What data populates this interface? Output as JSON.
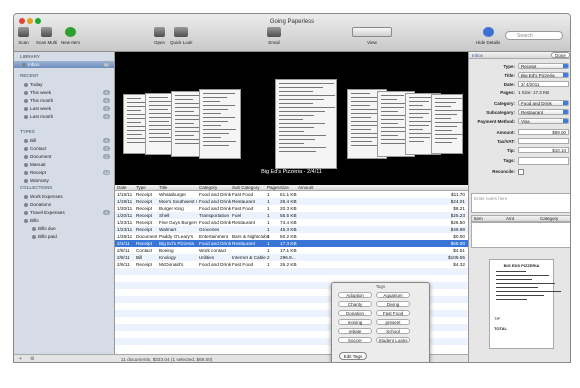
{
  "window": {
    "title": "Going Paperless"
  },
  "toolbar": {
    "scan": "Scan",
    "scan_multi": "Scan Multi",
    "new_item": "New Item",
    "open": "Open",
    "quick_look": "Quick Look",
    "email": "Email",
    "view": "View",
    "hide_details": "Hide Details",
    "search_placeholder": "Search"
  },
  "sidebar": {
    "library_header": "LIBRARY",
    "inbox": "Inbox",
    "inbox_count": "51",
    "recent_header": "RECENT",
    "recent": [
      {
        "label": "Today",
        "count": ""
      },
      {
        "label": "This week",
        "count": "4"
      },
      {
        "label": "This month",
        "count": "6"
      },
      {
        "label": "Last week",
        "count": "3"
      },
      {
        "label": "Last month",
        "count": "9"
      }
    ],
    "types_header": "TYPES",
    "types": [
      {
        "label": "Bill",
        "count": "4"
      },
      {
        "label": "Contact",
        "count": "3"
      },
      {
        "label": "Document",
        "count": "2"
      },
      {
        "label": "Manual",
        "count": ""
      },
      {
        "label": "Receipt",
        "count": "18"
      },
      {
        "label": "Warranty",
        "count": ""
      }
    ],
    "collections_header": "COLLECTIONS",
    "collections": [
      {
        "label": "Work Expenses",
        "count": ""
      },
      {
        "label": "Donations",
        "count": ""
      },
      {
        "label": "Travel Expenses",
        "count": "4"
      }
    ],
    "bills": "Bills",
    "bills_due": "Bills due",
    "bills_paid": "Bills paid"
  },
  "coverflow": {
    "caption": "Big Ed's Pizzeria - 2/4/11"
  },
  "table": {
    "columns": [
      "Date",
      "Type",
      "Title",
      "Category",
      "Sub Category",
      "Pages",
      "Size",
      "Amount"
    ],
    "rows": [
      [
        "1/15/11",
        "Receipt",
        "Whataburger",
        "Food and Drink",
        "Fast Food",
        "1",
        "61.1 KB",
        "$11.70"
      ],
      [
        "1/19/11",
        "Receipt",
        "Moe's Southwest Grill",
        "Food and Drink",
        "Restaurant",
        "1",
        "26.4 KB",
        "$24.01"
      ],
      [
        "1/20/11",
        "Receipt",
        "Burger King",
        "Food and Drink",
        "Fast Food",
        "1",
        "20.3 KB",
        "$8.21"
      ],
      [
        "1/20/11",
        "Receipt",
        "Shell",
        "Transportation",
        "Fuel",
        "1",
        "55.5 KB",
        "$25.23"
      ],
      [
        "1/23/11",
        "Receipt",
        "Five Guys Burgers...",
        "Food and Drink",
        "Restaurant",
        "1",
        "74.4 KB",
        "$26.50"
      ],
      [
        "1/23/11",
        "Receipt",
        "Walmart",
        "Groceries",
        "",
        "1",
        "45.3 KB",
        "$49.99"
      ],
      [
        "1/28/11",
        "Document",
        "Paddy O'Leary's",
        "Entertainment",
        "Bars & Nightclubs",
        "1",
        "60.2 KB",
        "$0.00"
      ],
      [
        "2/4/11",
        "Receipt",
        "Big Ed's Pizzeria",
        "Food and Drink",
        "Restaurant",
        "1",
        "17.3 KB",
        "$69.00"
      ],
      [
        "2/9/11",
        "Contact",
        "Boeing",
        "Work contact",
        "",
        "1",
        "17.1 KB",
        "$4.51"
      ],
      [
        "2/9/11",
        "Bill",
        "Knology",
        "Utilities",
        "Internet & Cable",
        "2",
        "296.8...",
        "$109.55"
      ],
      [
        "2/9/11",
        "Receipt",
        "McDonald's",
        "Food and Drink",
        "Fast Food",
        "1",
        "26.2 KB",
        "$4.32"
      ]
    ],
    "selected_index": 7
  },
  "status": "11 documents, $333.04 (1 selected, $69.00)",
  "tags_panel": {
    "title": "Tags",
    "tags": [
      "Adoption",
      "Aquarium",
      "Charity",
      "Diving",
      "Donation",
      "Fast Food",
      "moving",
      "present",
      "rebate",
      "School",
      "Soccer",
      "Student Loans"
    ],
    "edit": "Edit Tags"
  },
  "inspector": {
    "header": "Inbox",
    "done": "Done",
    "fields": [
      {
        "label": "Type:",
        "value": "Receipt",
        "kind": "select"
      },
      {
        "label": "Title:",
        "value": "Big Ed's Pizzeria",
        "kind": "select"
      },
      {
        "label": "Date:",
        "value": "2/ 4/2011",
        "kind": "date"
      },
      {
        "label": "Pages:",
        "value": "1   Size: 17.3 KB",
        "kind": "text"
      },
      {
        "label": "Category:",
        "value": "Food and Drink",
        "kind": "select"
      },
      {
        "label": "Subcategory:",
        "value": "Restaurant",
        "kind": "select"
      },
      {
        "label": "Payment Method:",
        "value": "Visa",
        "kind": "select"
      },
      {
        "label": "Amount:",
        "value": "$69.00",
        "kind": "num"
      },
      {
        "label": "Tax/VAT:",
        "value": "",
        "kind": "num"
      },
      {
        "label": "Tip:",
        "value": "$10.10",
        "kind": "num"
      },
      {
        "label": "Tags:",
        "value": "",
        "kind": "input"
      },
      {
        "label": "Reconcile:",
        "value": "",
        "kind": "check"
      }
    ],
    "notes_placeholder": "Enter notes here",
    "item_headers": [
      "Item",
      "Amt",
      "Category"
    ],
    "receipt": {
      "name": "BIG EDS PIZZERIA",
      "total_label": "TOTAL",
      "tip_label": "TIP"
    }
  },
  "colors": {
    "selection": "#3875d7",
    "sidebar_bg": "#d5dce5",
    "accent_blue": "#3d7be0"
  }
}
